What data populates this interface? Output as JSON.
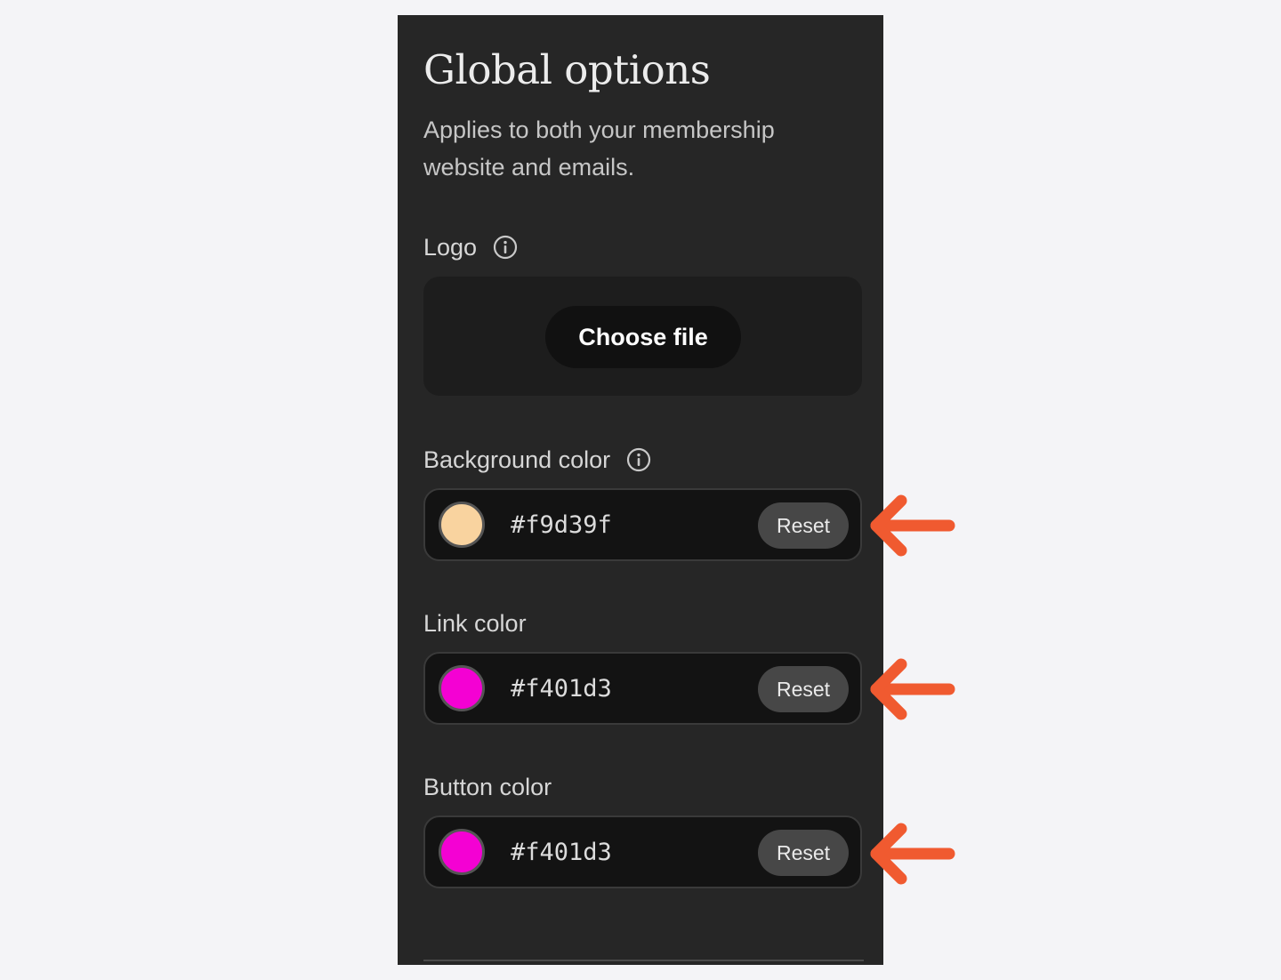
{
  "panel": {
    "title": "Global options",
    "subtitle": "Applies to both your membership website and emails."
  },
  "logo": {
    "label": "Logo",
    "info_icon": "info-circle-icon",
    "choose_button_label": "Choose file"
  },
  "background_color": {
    "label": "Background color",
    "info_icon": "info-circle-icon",
    "value": "#f9d39f",
    "swatch_color": "#f9d39f",
    "reset_label": "Reset"
  },
  "link_color": {
    "label": "Link color",
    "value": "#f401d3",
    "swatch_color": "#f401d3",
    "reset_label": "Reset"
  },
  "button_color": {
    "label": "Button color",
    "value": "#f401d3",
    "swatch_color": "#f401d3",
    "reset_label": "Reset"
  },
  "annotations": {
    "arrow_icon": "arrow-left-icon",
    "arrow_color": "#f05a30"
  }
}
